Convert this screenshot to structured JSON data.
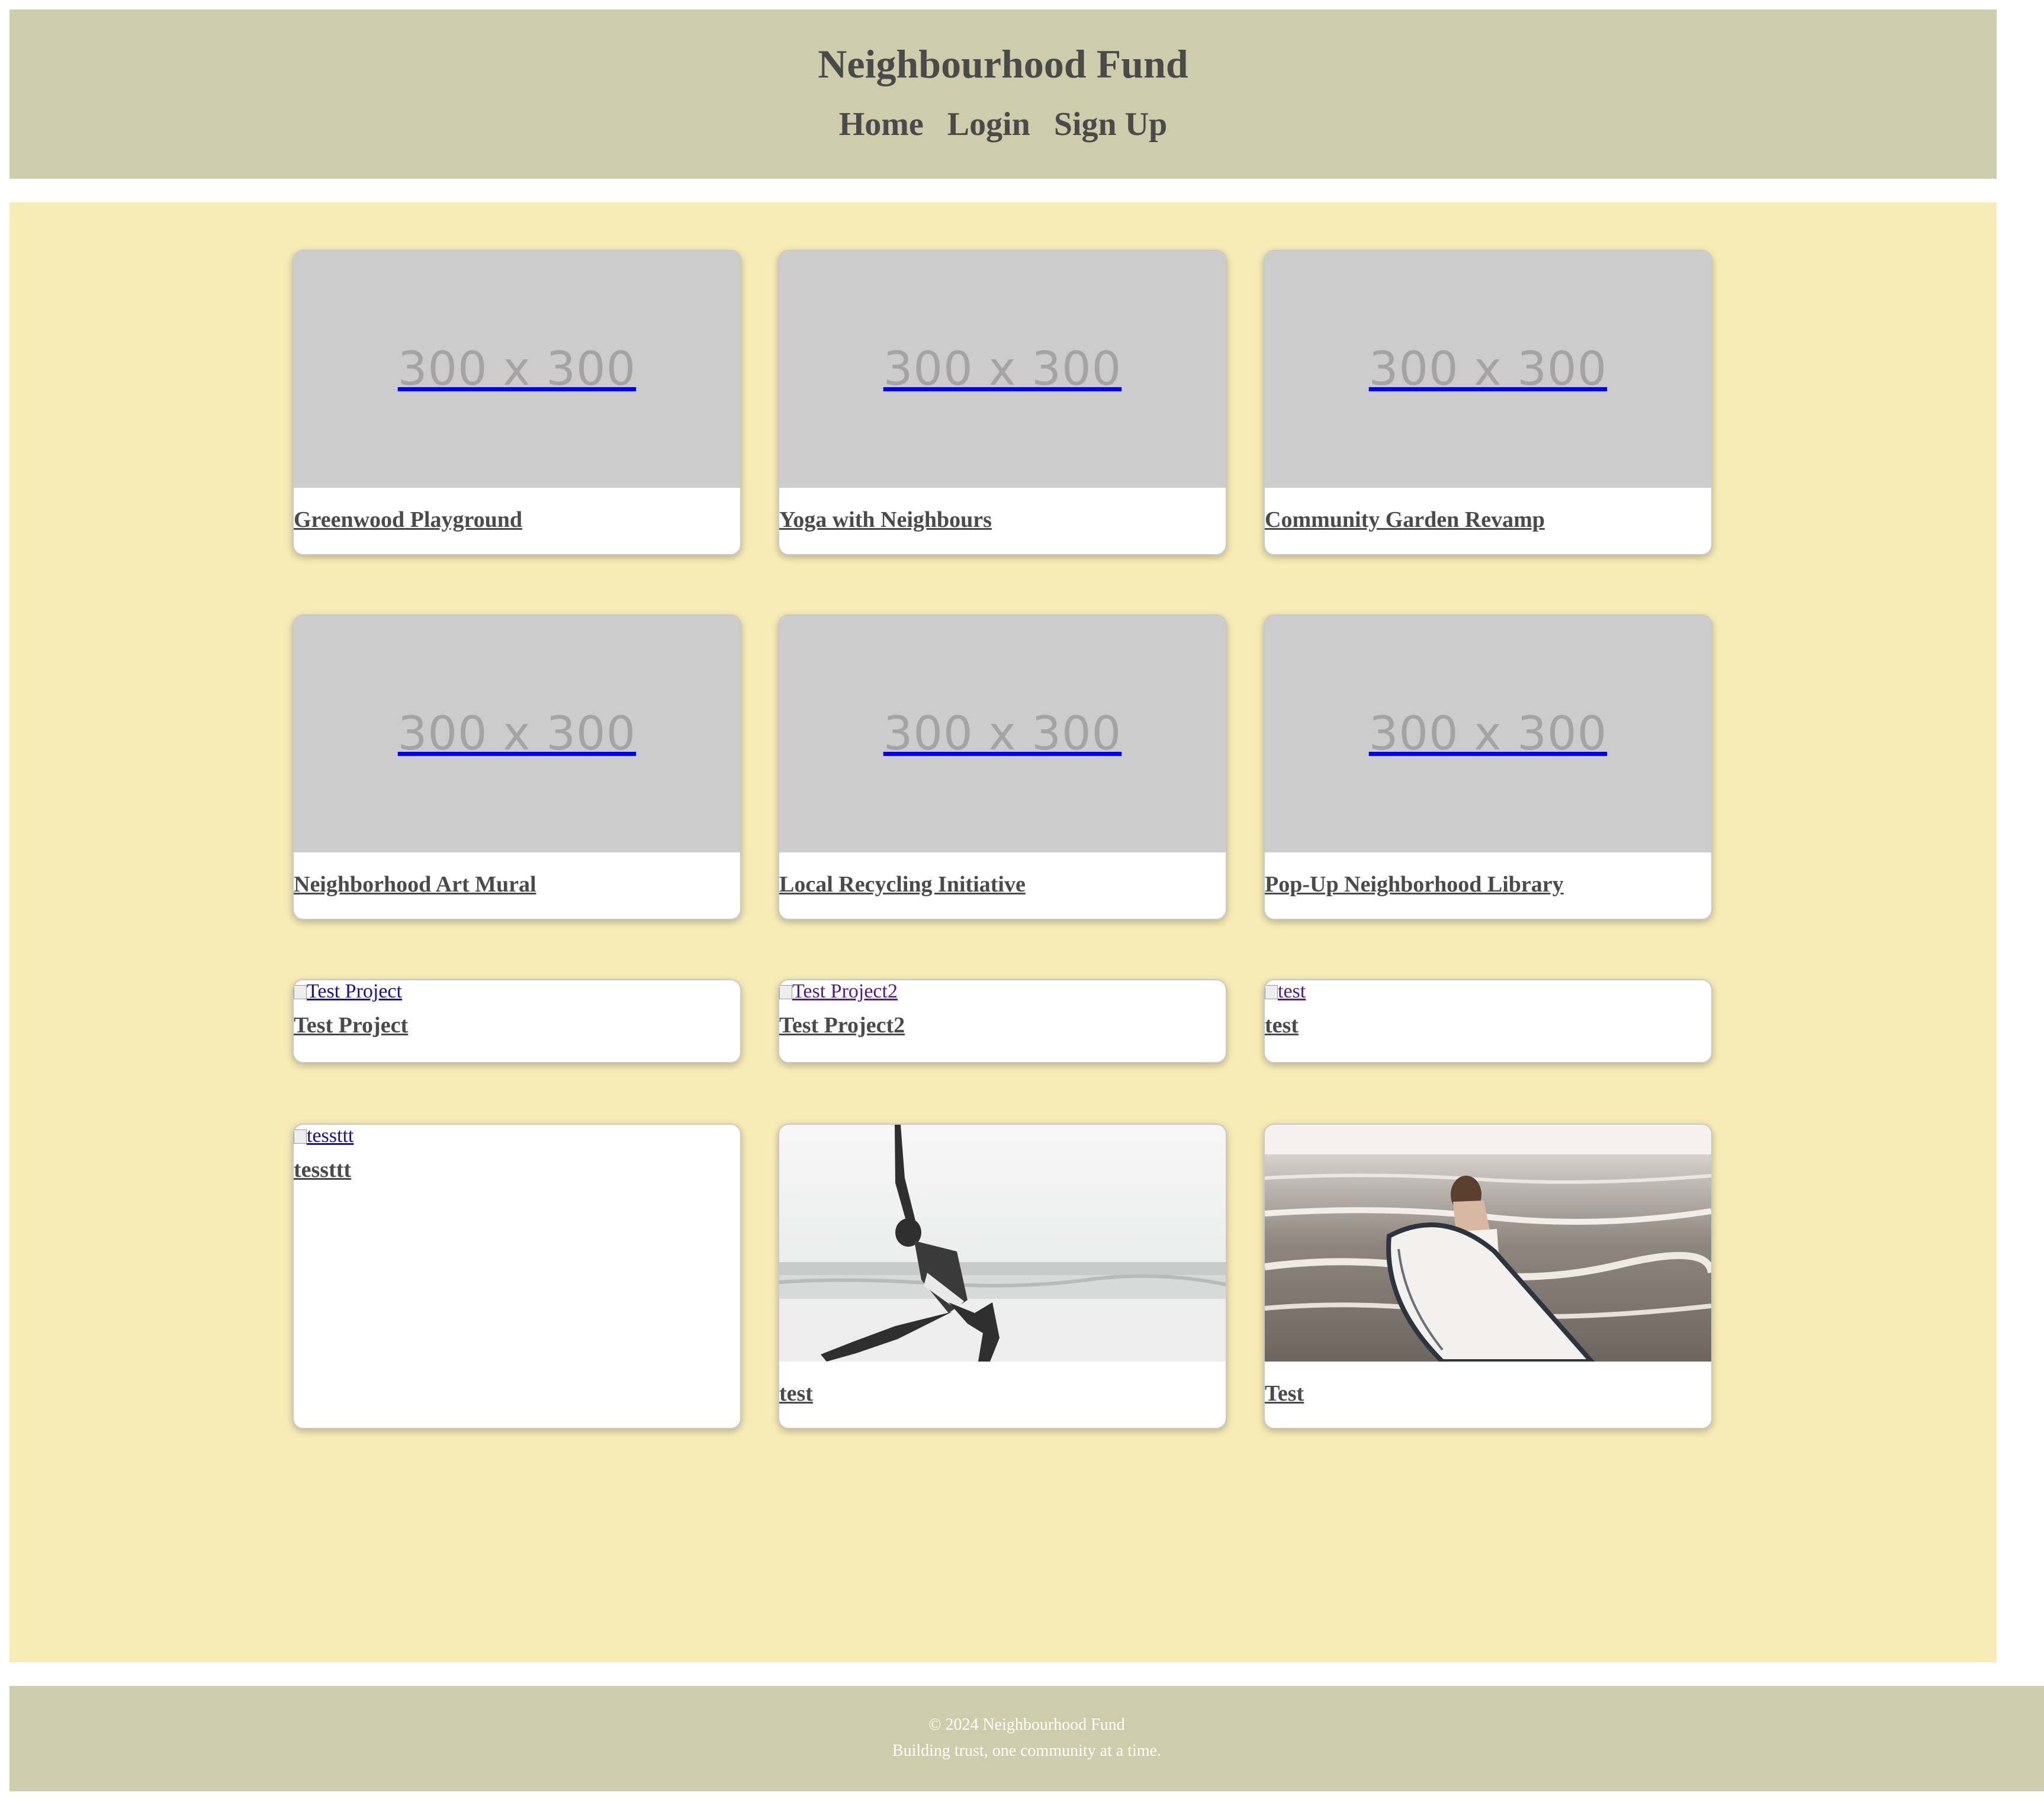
{
  "header": {
    "title": "Neighbourhood Fund",
    "nav": [
      "Home",
      "Login",
      "Sign Up"
    ]
  },
  "projects": [
    {
      "title": "Greenwood Playground",
      "image": "placeholder",
      "placeholder_text": "300 x 300"
    },
    {
      "title": "Yoga with Neighbours",
      "image": "placeholder",
      "placeholder_text": "300 x 300"
    },
    {
      "title": "Community Garden Revamp",
      "image": "placeholder",
      "placeholder_text": "300 x 300"
    },
    {
      "title": "Neighborhood Art Mural",
      "image": "placeholder",
      "placeholder_text": "300 x 300"
    },
    {
      "title": "Local Recycling Initiative",
      "image": "placeholder",
      "placeholder_text": "300 x 300"
    },
    {
      "title": "Pop-Up Neighborhood Library",
      "image": "placeholder",
      "placeholder_text": "300 x 300"
    },
    {
      "title": "Test Project",
      "image": "broken",
      "alt": "Test Project"
    },
    {
      "title": "Test Project2",
      "image": "broken",
      "alt": "Test Project2"
    },
    {
      "title": "test",
      "image": "broken",
      "alt": "test"
    },
    {
      "title": "tessttt",
      "image": "broken",
      "alt": "tessttt"
    },
    {
      "title": "test",
      "image": "photo-yoga"
    },
    {
      "title": "Test",
      "image": "photo-surfer"
    }
  ],
  "footer": {
    "copyright": "© 2024 Neighbourhood Fund",
    "tagline": "Building trust, one community at a time."
  },
  "colors": {
    "header_bg": "#cdcdab",
    "main_bg": "#f7ecb6",
    "text_dark": "#4a4a4a",
    "link_blue": "#1a0dab"
  }
}
